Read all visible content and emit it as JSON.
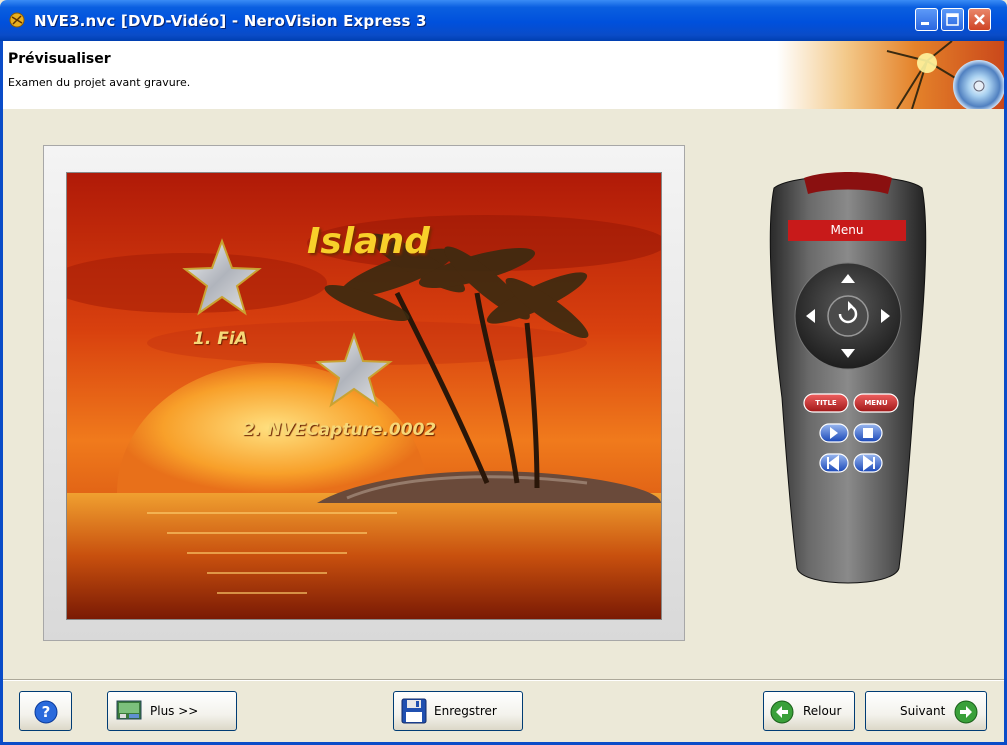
{
  "window": {
    "title": "NVE3.nvc [DVD-Vidéo] - NeroVision Express 3"
  },
  "header": {
    "title": "Prévisualiser",
    "subtitle": "Examen du projet avant gravure."
  },
  "preview": {
    "menu_title": "Island",
    "items": [
      {
        "label": "1. FiA"
      },
      {
        "label": "2. NVECapture.0002"
      }
    ]
  },
  "remote": {
    "menu_label": "Menu",
    "title_button": "TITLE",
    "menu_button": "MENU"
  },
  "footer": {
    "more_label": "Plus >>",
    "save_label": "Enregstrer",
    "back_label": "Relour",
    "next_label": "Suivant"
  }
}
